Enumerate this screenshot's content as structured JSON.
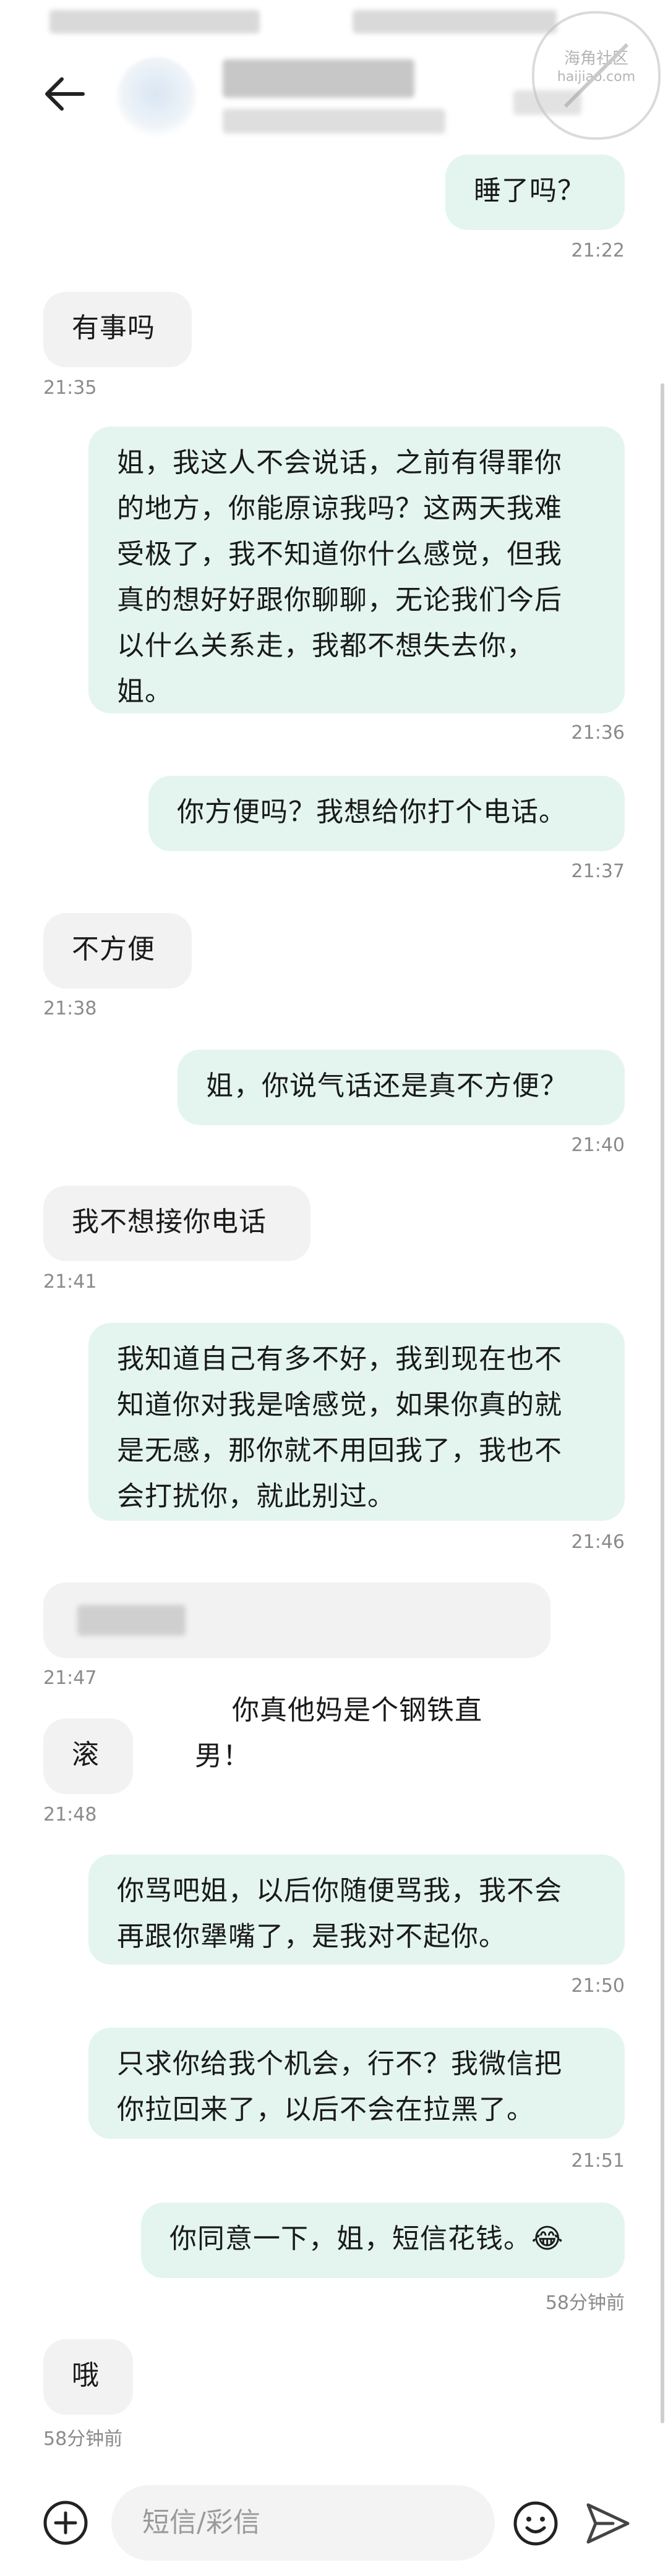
{
  "conversation": {
    "messages": [
      {
        "side": "sent",
        "text": "睡了吗？",
        "time": "21:22"
      },
      {
        "side": "recv",
        "text": "有事吗",
        "time": "21:35"
      },
      {
        "side": "sent",
        "text": "姐，我这人不会说话，之前有得罪你\n的地方，你能原谅我吗？这两天我难\n受极了，我不知道你什么感觉，但我\n真的想好好跟你聊聊，无论我们今后\n以什么关系走，我都不想失去你，\n姐。",
        "time": "21:36"
      },
      {
        "side": "sent",
        "text": "你方便吗？我想给你打个电话。",
        "time": "21:37"
      },
      {
        "side": "recv",
        "text": "不方便",
        "time": "21:38"
      },
      {
        "side": "sent",
        "text": "姐，你说气话还是真不方便？",
        "time": "21:40"
      },
      {
        "side": "recv",
        "text": "我不想接你电话",
        "time": "21:41"
      },
      {
        "side": "sent",
        "text": "我知道自己有多不好，我到现在也不\n知道你对我是啥感觉，如果你真的就\n是无感，那你就不用回我了，我也不\n会打扰你，就此别过。",
        "time": "21:46"
      },
      {
        "side": "recv",
        "text": "你真他妈是个钢铁直男！",
        "time": "21:47"
      },
      {
        "side": "recv",
        "text": "滚",
        "time": "21:48"
      },
      {
        "side": "sent",
        "text": "你骂吧姐，以后你随便骂我，我不会\n再跟你犟嘴了，是我对不起你。",
        "time": "21:50"
      },
      {
        "side": "sent",
        "text": "只求你给我个机会，行不？我微信把\n你拉回来了，以后不会在拉黑了。",
        "time": "21:51"
      },
      {
        "side": "sent",
        "text": "你同意一下，姐，短信花钱。😂",
        "time": "58分钟前"
      },
      {
        "side": "recv",
        "text": "哦",
        "time": "58分钟前"
      }
    ]
  },
  "composer": {
    "placeholder": "短信/彩信",
    "icons": [
      "add-icon",
      "emoji-icon",
      "send-icon"
    ]
  },
  "watermark": {
    "line1": "海角社区",
    "line2": "haijiao.com"
  },
  "colors": {
    "sent_bubble": "#e3f5ee",
    "recv_bubble": "#f2f2f2",
    "time": "#8a8a8a"
  }
}
